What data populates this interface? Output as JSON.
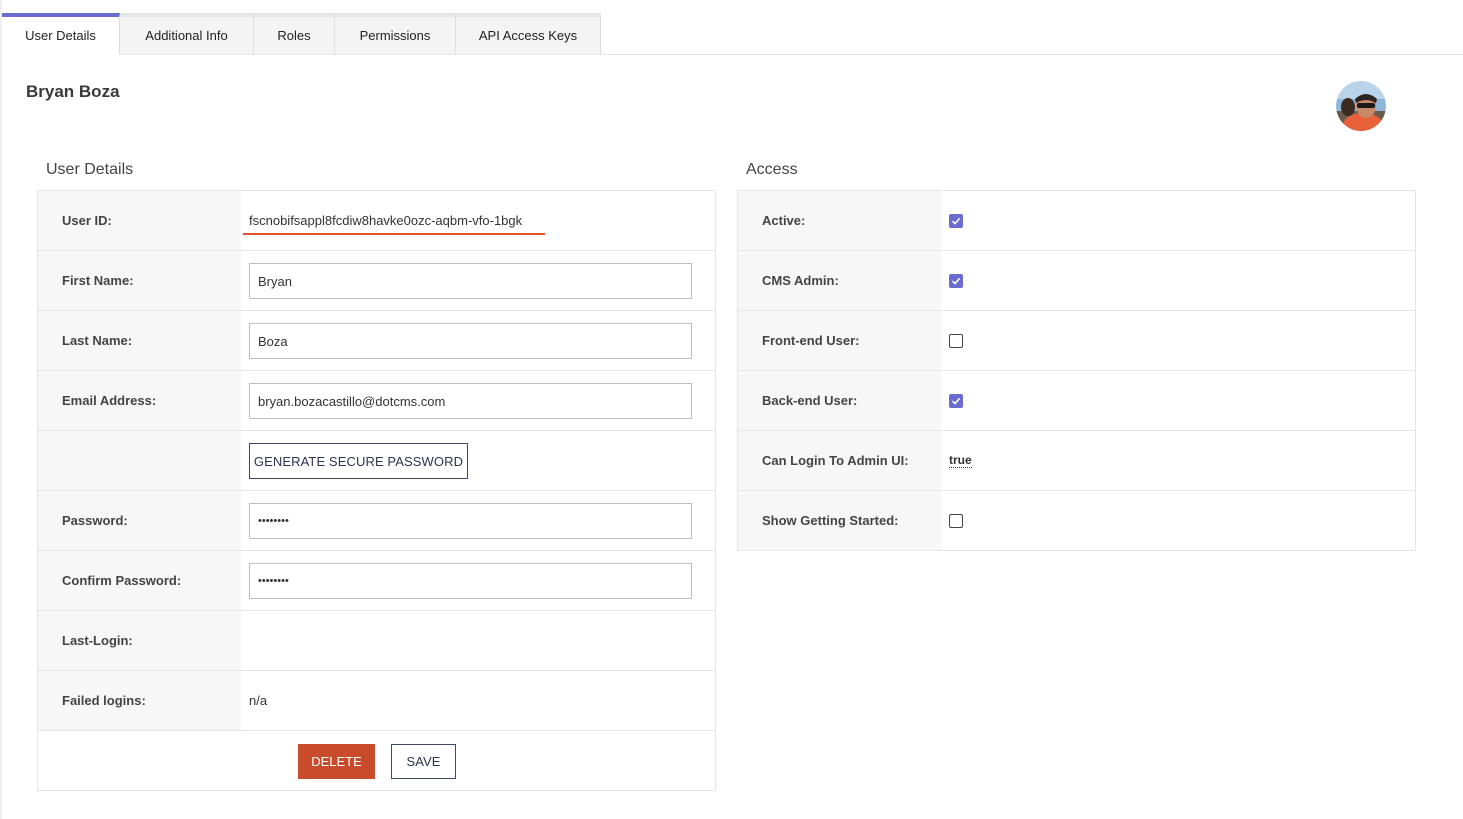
{
  "tabs": [
    {
      "label": "User Details",
      "active": true
    },
    {
      "label": "Additional Info",
      "active": false
    },
    {
      "label": "Roles",
      "active": false
    },
    {
      "label": "Permissions",
      "active": false
    },
    {
      "label": "API Access Keys",
      "active": false
    }
  ],
  "header": {
    "user_name": "Bryan Boza"
  },
  "user_details": {
    "title": "User Details",
    "user_id_label": "User ID:",
    "user_id_value": "fscnobifsappl8fcdiw8havke0ozc-aqbm-vfo-1bgk",
    "first_name_label": "First Name:",
    "first_name_value": "Bryan",
    "last_name_label": "Last Name:",
    "last_name_value": "Boza",
    "email_label": "Email Address:",
    "email_value": "bryan.bozacastillo@dotcms.com",
    "generate_password_label": "GENERATE SECURE PASSWORD",
    "password_label": "Password:",
    "password_value": "••••••••",
    "confirm_password_label": "Confirm Password:",
    "confirm_password_value": "••••••••",
    "last_login_label": "Last-Login:",
    "last_login_value": "",
    "failed_logins_label": "Failed logins:",
    "failed_logins_value": "n/a",
    "delete_label": "DELETE",
    "save_label": "SAVE"
  },
  "access": {
    "title": "Access",
    "active_label": "Active:",
    "active_checked": true,
    "cms_admin_label": "CMS Admin:",
    "cms_admin_checked": true,
    "frontend_label": "Front-end User:",
    "frontend_checked": false,
    "backend_label": "Back-end User:",
    "backend_checked": true,
    "can_login_label": "Can Login To Admin UI:",
    "can_login_value": "true",
    "show_getting_started_label": "Show Getting Started:",
    "show_getting_started_checked": false
  },
  "colors": {
    "accent": "#6a6cd0",
    "danger": "#c84b2c",
    "id_underline": "#e0532a"
  },
  "icons": {
    "avatar": "user-avatar-photo",
    "checked": "checkmark-icon"
  }
}
